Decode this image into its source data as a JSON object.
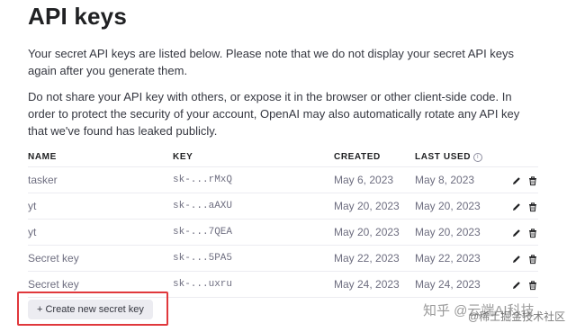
{
  "page": {
    "title": "API keys",
    "intro": "Your secret API keys are listed below. Please note that we do not display your secret API keys again after you generate them.",
    "warning": "Do not share your API key with others, or expose it in the browser or other client-side code. In order to protect the security of your account, OpenAI may also automatically rotate any API key that we've found has leaked publicly."
  },
  "table": {
    "headers": {
      "name": "NAME",
      "key": "KEY",
      "created": "CREATED",
      "last_used": "LAST USED"
    },
    "info_icon": "info-icon",
    "rows": [
      {
        "name": "tasker",
        "key": "sk-...rMxQ",
        "created": "May 6, 2023",
        "last_used": "May 8, 2023"
      },
      {
        "name": "yt",
        "key": "sk-...aAXU",
        "created": "May 20, 2023",
        "last_used": "May 20, 2023"
      },
      {
        "name": "yt",
        "key": "sk-...7QEA",
        "created": "May 20, 2023",
        "last_used": "May 20, 2023"
      },
      {
        "name": "Secret key",
        "key": "sk-...5PA5",
        "created": "May 22, 2023",
        "last_used": "May 22, 2023"
      },
      {
        "name": "Secret key",
        "key": "sk-...uxru",
        "created": "May 24, 2023",
        "last_used": "May 24, 2023"
      }
    ],
    "row_actions": [
      "pencil-icon",
      "trash-icon"
    ]
  },
  "create_button": {
    "icon": "plus-icon",
    "label": "+ Create new secret key"
  },
  "watermark": {
    "line1": "知乎 @云端AI科技",
    "line2": "@稀土掘金技术社区"
  },
  "colors": {
    "highlight_border": "#e0383c",
    "button_bg": "#ececf1",
    "text_muted": "#6e6e80"
  }
}
